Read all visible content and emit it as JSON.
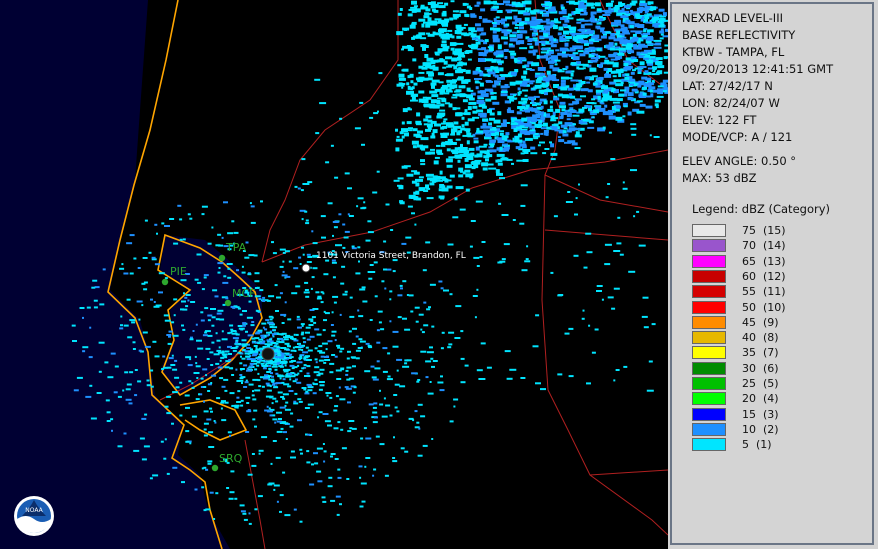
{
  "header": {
    "product": "NEXRAD LEVEL-III",
    "product_type": "BASE REFLECTIVITY",
    "station": "KTBW - TAMPA, FL",
    "datetime": "09/20/2013 12:41:51 GMT",
    "lat": "LAT: 27/42/17 N",
    "lon": "LON: 82/24/07 W",
    "elev": "ELEV: 122 FT",
    "mode": "MODE/VCP: A / 121",
    "elev_angle": "ELEV ANGLE: 0.50 °",
    "max": "MAX: 53 dBZ"
  },
  "legend": {
    "title": "Legend: dBZ (Category)",
    "items": [
      {
        "label": "75  (15)",
        "color": "#e8e8e8"
      },
      {
        "label": "70  (14)",
        "color": "#9955cc"
      },
      {
        "label": "65  (13)",
        "color": "#ff00ff"
      },
      {
        "label": "60  (12)",
        "color": "#c80000"
      },
      {
        "label": "55  (11)",
        "color": "#d40000"
      },
      {
        "label": "50  (10)",
        "color": "#ff0000"
      },
      {
        "label": "45  (9)",
        "color": "#ff8c00"
      },
      {
        "label": "40  (8)",
        "color": "#e6b800"
      },
      {
        "label": "35  (7)",
        "color": "#ffff00"
      },
      {
        "label": "30  (6)",
        "color": "#008c00"
      },
      {
        "label": "25  (5)",
        "color": "#00c000"
      },
      {
        "label": "20  (4)",
        "color": "#00ff00"
      },
      {
        "label": "15  (3)",
        "color": "#0000ff"
      },
      {
        "label": "10  (2)",
        "color": "#1e90ff"
      },
      {
        "label": "5  (1)",
        "color": "#00e5ff"
      }
    ]
  },
  "map": {
    "cities": {
      "tpa": "TPA",
      "pie": "PIE",
      "mcf": "MCF",
      "srq": "SRQ"
    },
    "address": "1101 Victoria Street, Brandon, FL",
    "logo_text": "NOAA",
    "colors": {
      "gulf": "#000033",
      "land": "#000000",
      "coast": "#ffa500",
      "county": "#b02020"
    }
  }
}
